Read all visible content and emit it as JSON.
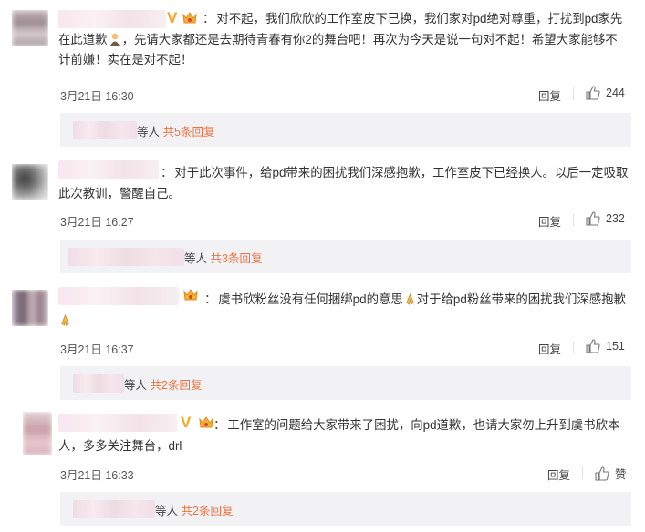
{
  "comments": [
    {
      "text": "对不起，我们欣欣的工作室皮下已换，我们家对pd绝对尊重，打扰到pd家先在此道歉",
      "text_tail": "，先请大家都还是去期待青春有你2的舞台吧！再次为今天是说一句对不起！希望大家能够不计前嫌！实在是对不起！",
      "time": "3月21日 16:30",
      "reply_label": "回复",
      "likes": "244",
      "sub_suffix": "等人",
      "sub_more": "共5条回复"
    },
    {
      "text": "对于此次事件，给pd带来的困扰我们深感抱歉，工作室皮下已经换人。以后一定吸取此次教训，警醒自己。",
      "time": "3月21日 16:27",
      "reply_label": "回复",
      "likes": "232",
      "sub_suffix": "等人",
      "sub_more": "共3条回复"
    },
    {
      "text": "虞书欣粉丝没有任何捆绑pd的意思",
      "text_mid": "对于给pd粉丝带来的困扰我们深感抱歉",
      "time": "3月21日 16:37",
      "reply_label": "回复",
      "likes": "151",
      "sub_suffix": "等人",
      "sub_more": "共2条回复"
    },
    {
      "text": "工作室的问题给大家带来了困扰，向pd道歉，也请大家勿上升到虞书欣本人，多多关注舞台，drl",
      "time": "3月21日 16:33",
      "reply_label": "回复",
      "likes": "赞",
      "sub_suffix": "等人",
      "sub_more": "共2条回复"
    }
  ],
  "colon": "：",
  "colors": {
    "accent": "#eb7340",
    "vip": "#f5a623",
    "subbox": "#f2f2f5"
  },
  "icons": [
    "thumbs-up-icon",
    "verified-v-icon",
    "fan-crown-icon",
    "pray-icon",
    "bow-icon"
  ]
}
